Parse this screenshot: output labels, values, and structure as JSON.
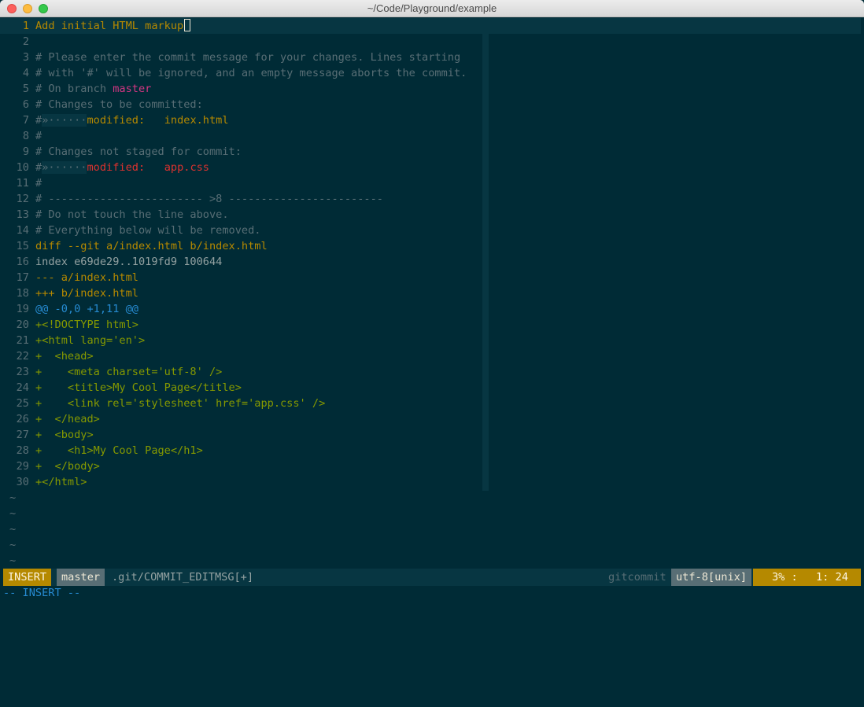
{
  "window": {
    "title": "~/Code/Playground/example"
  },
  "editor": {
    "lines": [
      {
        "n": "1",
        "current": true,
        "segments": [
          {
            "t": "Add initial HTML markup",
            "c": "summary"
          }
        ],
        "cursor": true
      },
      {
        "n": "2",
        "segments": []
      },
      {
        "n": "3",
        "segments": [
          {
            "t": "# Please enter the commit message for your changes. Lines starting",
            "c": "comment"
          }
        ]
      },
      {
        "n": "4",
        "segments": [
          {
            "t": "# with '#' will be ignored, and an empty message aborts the commit.",
            "c": "comment"
          }
        ]
      },
      {
        "n": "5",
        "segments": [
          {
            "t": "# On branch ",
            "c": "comment"
          },
          {
            "t": "master",
            "c": "branch"
          }
        ]
      },
      {
        "n": "6",
        "segments": [
          {
            "t": "# Changes to be committed:",
            "c": "comment"
          }
        ]
      },
      {
        "n": "7",
        "segments": [
          {
            "t": "#",
            "c": "comment"
          },
          {
            "t": "»······",
            "c": "tabhl"
          },
          {
            "t": "modified:   ",
            "c": "modified-g"
          },
          {
            "t": "index.html",
            "c": "file-g"
          }
        ]
      },
      {
        "n": "8",
        "segments": [
          {
            "t": "#",
            "c": "comment"
          }
        ]
      },
      {
        "n": "9",
        "segments": [
          {
            "t": "# Changes not staged for commit:",
            "c": "comment"
          }
        ]
      },
      {
        "n": "10",
        "segments": [
          {
            "t": "#",
            "c": "comment"
          },
          {
            "t": "»······",
            "c": "tabhl"
          },
          {
            "t": "modified:   ",
            "c": "modified-r"
          },
          {
            "t": "app.css",
            "c": "file-r"
          }
        ]
      },
      {
        "n": "11",
        "segments": [
          {
            "t": "#",
            "c": "comment"
          }
        ]
      },
      {
        "n": "12",
        "segments": [
          {
            "t": "# ------------------------ >8 ------------------------",
            "c": "comment"
          }
        ]
      },
      {
        "n": "13",
        "segments": [
          {
            "t": "# Do not touch the line above.",
            "c": "comment"
          }
        ]
      },
      {
        "n": "14",
        "segments": [
          {
            "t": "# Everything below will be removed.",
            "c": "comment"
          }
        ]
      },
      {
        "n": "15",
        "segments": [
          {
            "t": "diff --git a/index.html b/index.html",
            "c": "diffhdr"
          }
        ]
      },
      {
        "n": "16",
        "segments": [
          {
            "t": "index e69de29..1019fd9 100644",
            "c": "index"
          }
        ]
      },
      {
        "n": "17",
        "segments": [
          {
            "t": "--- a/index.html",
            "c": "minus"
          }
        ]
      },
      {
        "n": "18",
        "segments": [
          {
            "t": "+++ b/index.html",
            "c": "minus"
          }
        ]
      },
      {
        "n": "19",
        "segments": [
          {
            "t": "@@ -0,0 +1,11 @@",
            "c": "hunk"
          }
        ]
      },
      {
        "n": "20",
        "segments": [
          {
            "t": "+<!DOCTYPE html>",
            "c": "added"
          }
        ]
      },
      {
        "n": "21",
        "segments": [
          {
            "t": "+<html lang='en'>",
            "c": "added"
          }
        ]
      },
      {
        "n": "22",
        "segments": [
          {
            "t": "+  <head>",
            "c": "added"
          }
        ]
      },
      {
        "n": "23",
        "segments": [
          {
            "t": "+    <meta charset='utf-8' />",
            "c": "added"
          }
        ]
      },
      {
        "n": "24",
        "segments": [
          {
            "t": "+    <title>My Cool Page</title>",
            "c": "added"
          }
        ]
      },
      {
        "n": "25",
        "segments": [
          {
            "t": "+    <link rel='stylesheet' href='app.css' />",
            "c": "added"
          }
        ]
      },
      {
        "n": "26",
        "segments": [
          {
            "t": "+  </head>",
            "c": "added"
          }
        ]
      },
      {
        "n": "27",
        "segments": [
          {
            "t": "+  <body>",
            "c": "added"
          }
        ]
      },
      {
        "n": "28",
        "segments": [
          {
            "t": "+    <h1>My Cool Page</h1>",
            "c": "added"
          }
        ]
      },
      {
        "n": "29",
        "segments": [
          {
            "t": "+  </body>",
            "c": "added"
          }
        ]
      },
      {
        "n": "30",
        "segments": [
          {
            "t": "+</html>",
            "c": "added"
          }
        ]
      }
    ],
    "filler": [
      "~",
      "~",
      "~",
      "~",
      "~"
    ]
  },
  "statusline": {
    "mode": "INSERT",
    "branch": "master",
    "file": ".git/COMMIT_EDITMSG[+]",
    "filetype": "gitcommit",
    "encoding": "utf-8[unix]",
    "percent": "3% :",
    "position": "1: 24"
  },
  "cmdline": {
    "text": "-- INSERT --"
  },
  "colors": {
    "background": "#002b36",
    "accent_yellow": "#b58900",
    "magenta": "#d33682",
    "red": "#dc322f",
    "blue": "#268bd2",
    "green": "#859900"
  }
}
